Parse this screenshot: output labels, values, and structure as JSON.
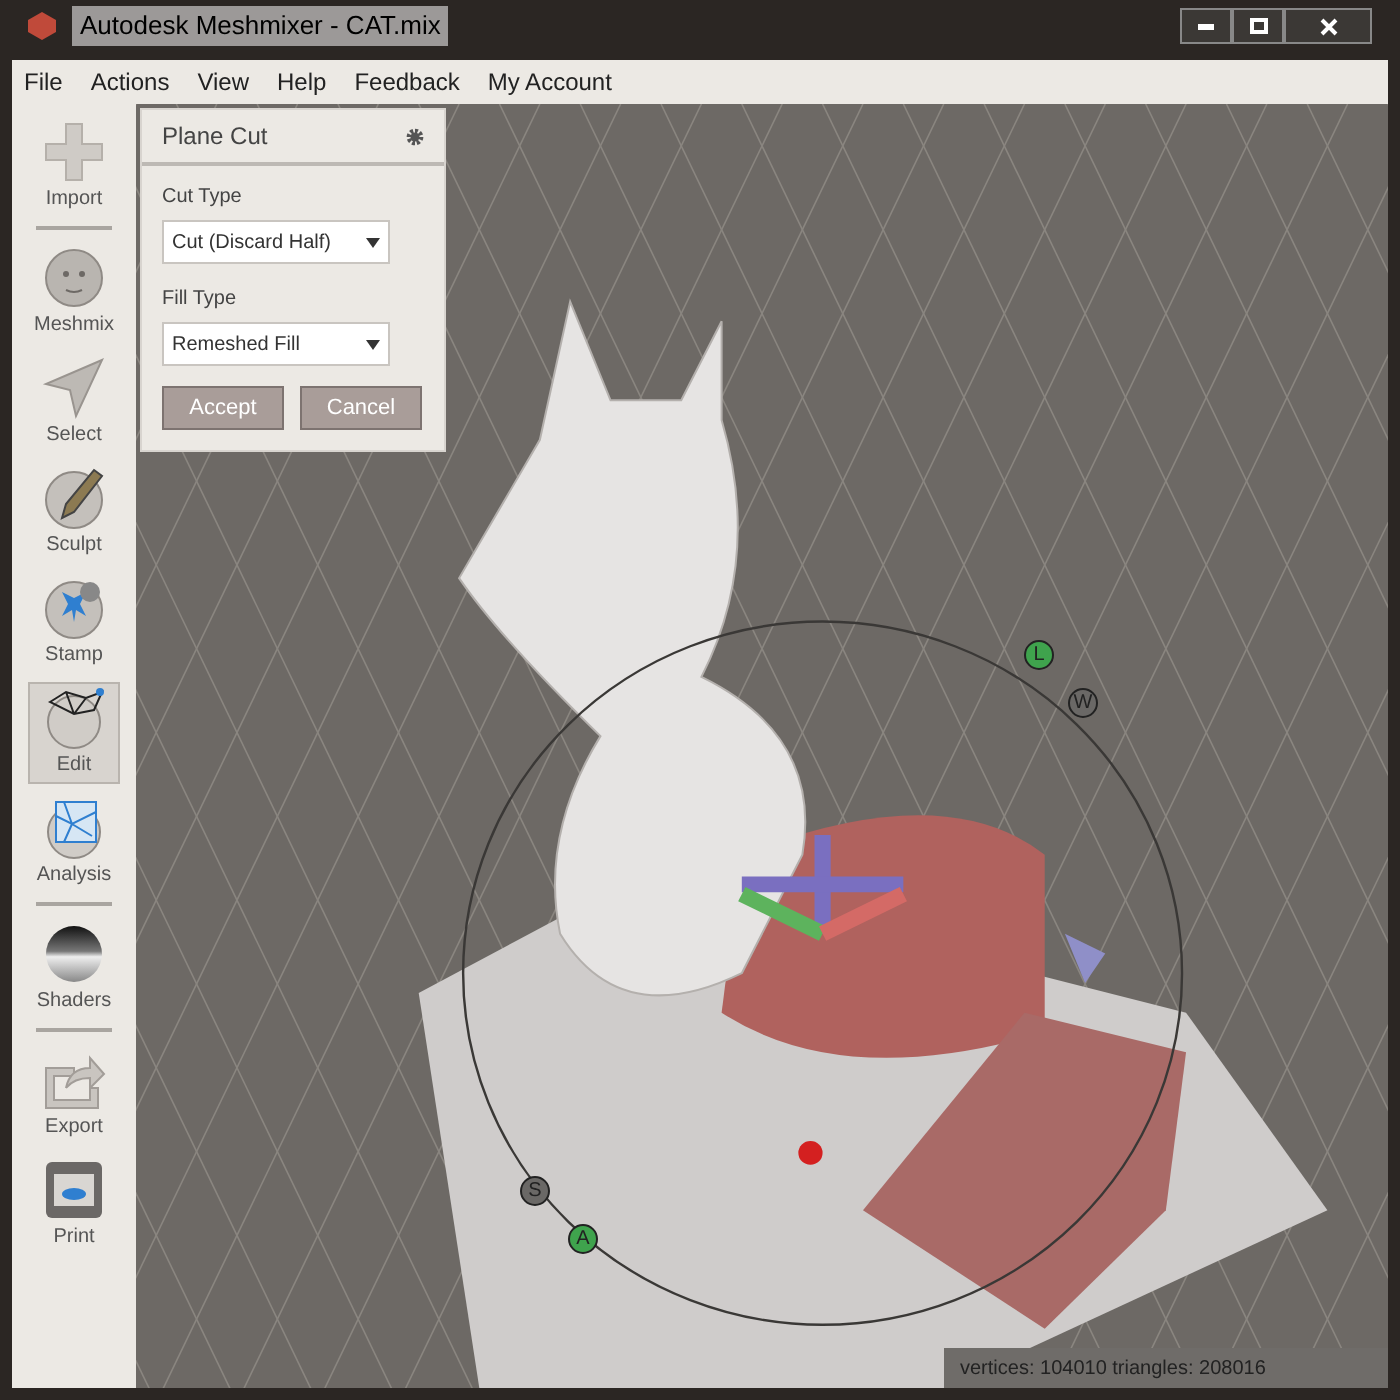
{
  "window": {
    "title": "Autodesk Meshmixer - CAT.mix"
  },
  "menu": [
    "File",
    "Actions",
    "View",
    "Help",
    "Feedback",
    "My Account"
  ],
  "tools": [
    {
      "kind": "import",
      "label": "Import",
      "selected": false,
      "divider_after": true
    },
    {
      "kind": "meshmix",
      "label": "Meshmix",
      "selected": false,
      "divider_after": false
    },
    {
      "kind": "select",
      "label": "Select",
      "selected": false,
      "divider_after": false
    },
    {
      "kind": "sculpt",
      "label": "Sculpt",
      "selected": false,
      "divider_after": false
    },
    {
      "kind": "stamp",
      "label": "Stamp",
      "selected": false,
      "divider_after": false
    },
    {
      "kind": "edit",
      "label": "Edit",
      "selected": true,
      "divider_after": false
    },
    {
      "kind": "analysis",
      "label": "Analysis",
      "selected": false,
      "divider_after": true
    },
    {
      "kind": "shaders",
      "label": "Shaders",
      "selected": false,
      "divider_after": true
    },
    {
      "kind": "export",
      "label": "Export",
      "selected": false,
      "divider_after": false
    },
    {
      "kind": "print",
      "label": "Print",
      "selected": false,
      "divider_after": false
    }
  ],
  "panel": {
    "title": "Plane Cut",
    "fields": [
      {
        "label": "Cut Type",
        "value": "Cut (Discard Half)"
      },
      {
        "label": "Fill Type",
        "value": "Remeshed Fill"
      }
    ],
    "buttons": [
      "Accept",
      "Cancel"
    ]
  },
  "gizmo_handles": [
    {
      "label": "L",
      "color": "#3fa34d"
    },
    {
      "label": "W",
      "color": "#6a6866"
    },
    {
      "label": "S",
      "color": "#6a6866"
    },
    {
      "label": "A",
      "color": "#3fa34d"
    }
  ],
  "status_bar": "vertices: 104010 triangles: 208016"
}
